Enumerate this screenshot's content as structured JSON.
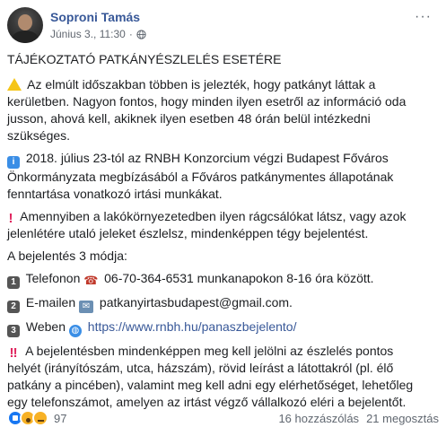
{
  "post": {
    "author": "Soproni Tamás",
    "date": "Június 3., 11:30",
    "separator": "·",
    "more_menu": "···"
  },
  "body": {
    "heading": "TÁJÉKOZTATÓ PATKÁNYÉSZLELÉS ESETÉRE",
    "paragraph1": "Az elmúlt időszakban többen is jelezték, hogy patkányt láttak a kerületben. Nagyon fontos, hogy minden ilyen esetről az információ oda jusson, ahová kell, akiknek ilyen esetben 48 órán belül intézkedni szükséges.",
    "paragraph2": "2018. július 23-tól az RNBH Konzorcium végzi Budapest Főváros Önkormányzata megbízásából a Főváros patkánymentes állapotának fenntartása vonatkozó irtási munkákat.",
    "paragraph3": "Amennyiben a lakókörnyezetedben ilyen rágcsálókat látsz, vagy azok jelenlétére utaló jeleket észlelsz, mindenképpen tégy bejelentést.",
    "ways_title": "A bejelentés 3 módja:",
    "way1_num": "1",
    "way1_pre": "Telefonon",
    "way1_post": "06-70-364-6531 munkanapokon 8-16 óra között.",
    "way2_num": "2",
    "way2_pre": "E-mailen",
    "way2_post": "patkanyirtasbudapest@gmail.com.",
    "way3_num": "3",
    "way3_pre": "Weben",
    "way3_link": "https://www.rnbh.hu/panaszbejelento/",
    "paragraph4": "A bejelentésben mindenképpen meg kell jelölni az észlelés pontos helyét (irányítószám, utca, házszám), rövid leírást a látottakról (pl. élő patkány a pincében), valamint meg kell adni egy elérhetőséget, lehetőleg egy telefonszámot, amelyen az irtást végző vállalkozó eléri a bejelentőt."
  },
  "footer": {
    "reaction_count": "97",
    "comments": "16 hozzászólás",
    "shares": "21 megosztás"
  },
  "icons": {
    "warning": "warning-icon",
    "info": "info-icon",
    "exclamation": "exclamation-icon",
    "double_exclamation": "double-exclamation-icon",
    "telephone": "telephone-icon",
    "email": "email-icon",
    "globe": "globe-icon"
  },
  "colors": {
    "author": "#385898",
    "link": "#385898",
    "text": "#1c1e21",
    "muted": "#606770"
  }
}
